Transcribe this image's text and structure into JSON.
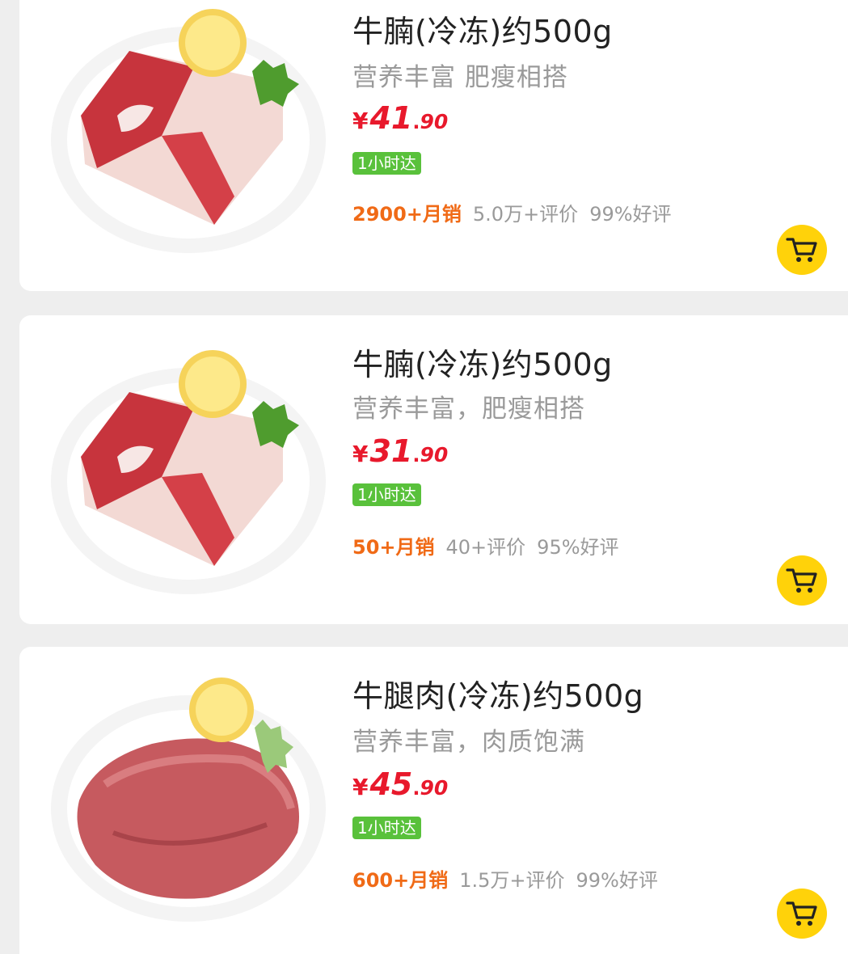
{
  "products": [
    {
      "title": "牛腩(冷冻)约500g",
      "subtitle": "营养丰富 肥瘦相搭",
      "price": {
        "currency": "¥",
        "integer": "41",
        "decimal_point": ".",
        "decimal": "90"
      },
      "delivery_badge": "1小时达",
      "sales": "2900+月销",
      "reviews": "5.0万+评价",
      "rating": "99%好评",
      "image": "beef-brisket-on-plate"
    },
    {
      "title": "牛腩(冷冻)约500g",
      "subtitle": "营养丰富，肥瘦相搭",
      "price": {
        "currency": "¥",
        "integer": "31",
        "decimal_point": ".",
        "decimal": "90"
      },
      "delivery_badge": "1小时达",
      "sales": "50+月销",
      "reviews": "40+评价",
      "rating": "95%好评",
      "image": "beef-brisket-on-plate"
    },
    {
      "title": "牛腿肉(冷冻)约500g",
      "subtitle": "营养丰富，肉质饱满",
      "price": {
        "currency": "¥",
        "integer": "45",
        "decimal_point": ".",
        "decimal": "90"
      },
      "delivery_badge": "1小时达",
      "sales": "600+月销",
      "reviews": "1.5万+评价",
      "rating": "99%好评",
      "image": "beef-leg-on-plate"
    }
  ],
  "icons": {
    "cart": "shopping-cart-icon"
  },
  "colors": {
    "price": "#e8192c",
    "sales": "#f06a16",
    "badge": "#59c13b",
    "cart_button": "#ffd20a",
    "muted_text": "#9a9a9a"
  }
}
